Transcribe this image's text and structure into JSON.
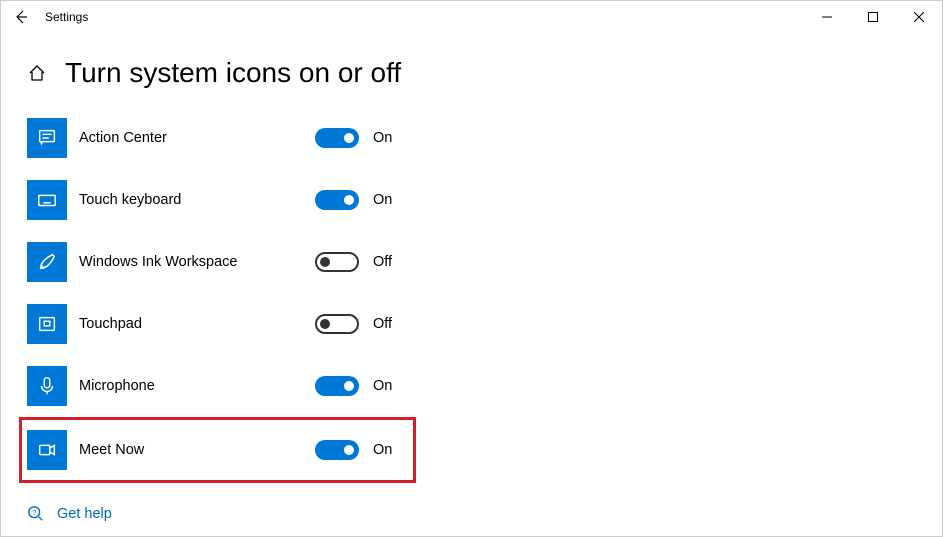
{
  "window": {
    "title": "Settings",
    "back_icon": "back-arrow",
    "minimize": "—",
    "maximize": "▢",
    "close": "✕"
  },
  "page": {
    "title": "Turn system icons on or off"
  },
  "state_labels": {
    "on": "On",
    "off": "Off"
  },
  "items": [
    {
      "icon": "action-center",
      "label": "Action Center",
      "state": "on",
      "highlight": false
    },
    {
      "icon": "touch-keyboard",
      "label": "Touch keyboard",
      "state": "on",
      "highlight": false
    },
    {
      "icon": "ink-workspace",
      "label": "Windows Ink Workspace",
      "state": "off",
      "highlight": false
    },
    {
      "icon": "touchpad",
      "label": "Touchpad",
      "state": "off",
      "highlight": false
    },
    {
      "icon": "microphone",
      "label": "Microphone",
      "state": "on",
      "highlight": false
    },
    {
      "icon": "meet-now",
      "label": "Meet Now",
      "state": "on",
      "highlight": true
    }
  ],
  "help": {
    "label": "Get help"
  }
}
